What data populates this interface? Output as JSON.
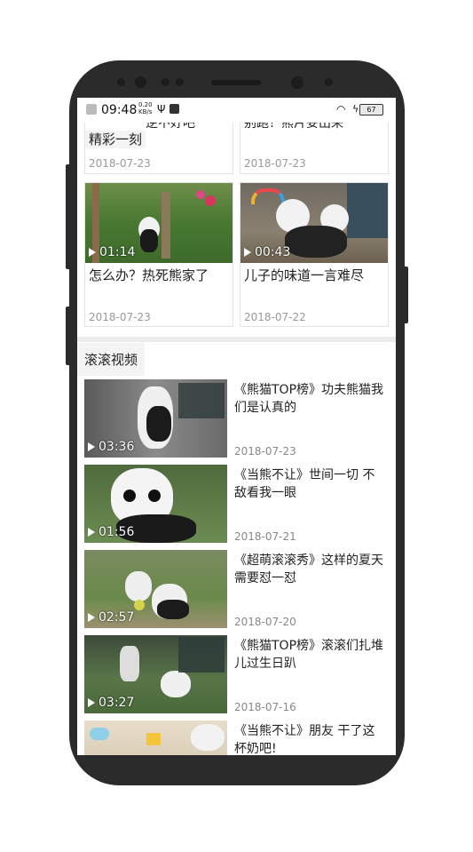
{
  "status": {
    "time": "09:48",
    "speed": "0.20",
    "speed_unit": "KB/s",
    "battery": "67"
  },
  "top_row": [
    {
      "title_line1": "逆不好吧",
      "title_line2": "精彩一刻",
      "date": "2018-07-23"
    },
    {
      "title_line1": "别跑！熊片妥出来",
      "date": "2018-07-23"
    }
  ],
  "grid": [
    {
      "duration": "01:14",
      "title": "怎么办？热死熊家了",
      "date": "2018-07-23"
    },
    {
      "duration": "00:43",
      "title": "儿子的味道一言难尽",
      "date": "2018-07-22"
    }
  ],
  "section_title": "滚滚视频",
  "videos": [
    {
      "duration": "03:36",
      "title": "《熊猫TOP榜》功夫熊猫我们是认真的",
      "date": "2018-07-23"
    },
    {
      "duration": "01:56",
      "title": "《当熊不让》世间一切 不敌看我一眼",
      "date": "2018-07-21"
    },
    {
      "duration": "02:57",
      "title": "《超萌滚滚秀》这样的夏天需要怼一怼",
      "date": "2018-07-20"
    },
    {
      "duration": "03:27",
      "title": "《熊猫TOP榜》滚滚们扎堆儿过生日趴",
      "date": "2018-07-16"
    },
    {
      "duration": "",
      "title": "《当熊不让》朋友 干了这杯奶吧!",
      "date": ""
    }
  ]
}
